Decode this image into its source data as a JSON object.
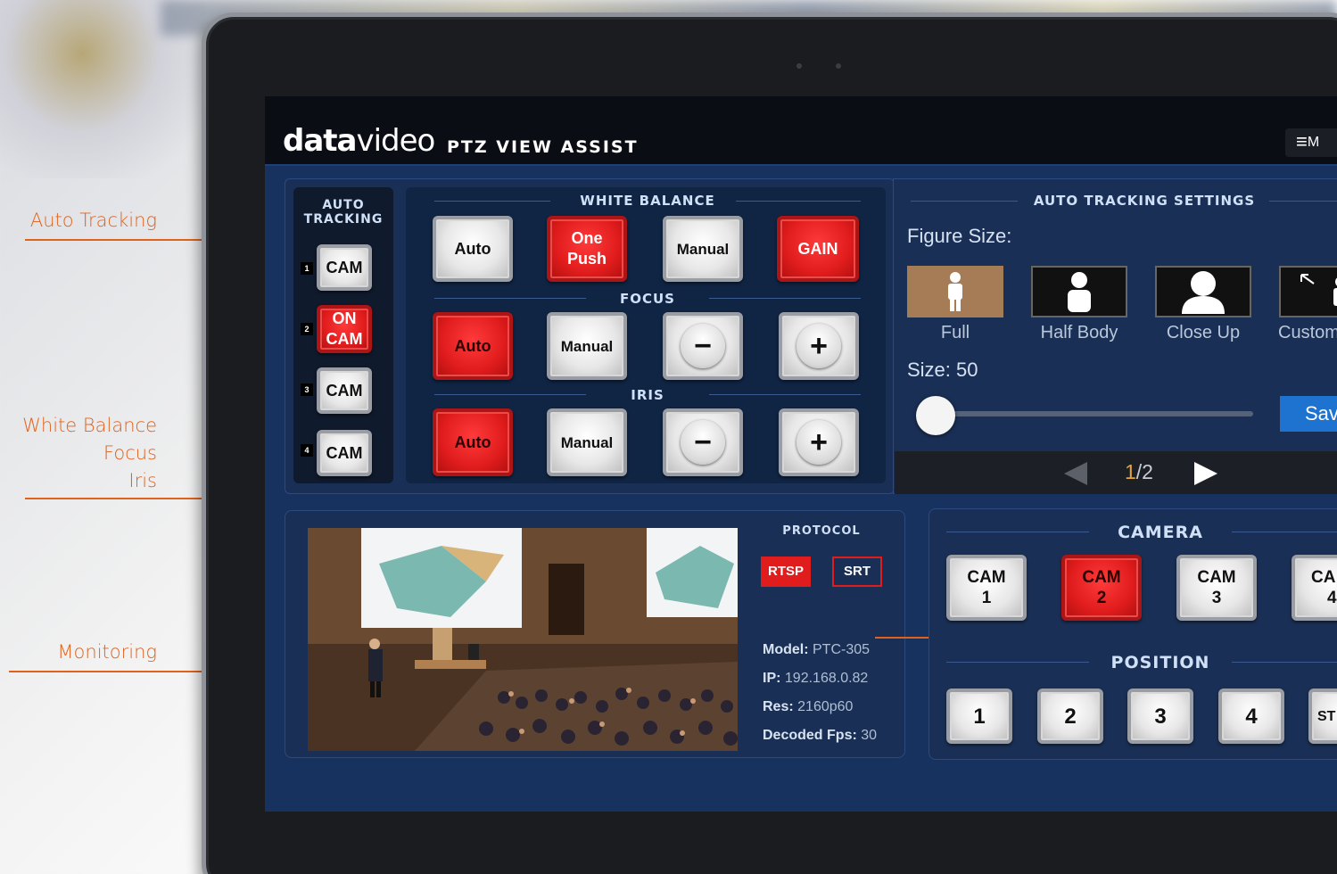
{
  "annotations": {
    "auto_tracking": "Auto Tracking",
    "white_balance": "White Balance",
    "focus": "Focus",
    "iris": "Iris",
    "monitoring": "Monitoring"
  },
  "header": {
    "brand_bold": "data",
    "brand_light": "video",
    "title": "PTZ VIEW ASSIST",
    "menu_label": "M"
  },
  "auto_tracking_panel": {
    "title_line1": "AUTO",
    "title_line2": "TRACKING",
    "cams": [
      {
        "num": "1",
        "label": "CAM",
        "active": false
      },
      {
        "num": "2",
        "label_line1": "ON",
        "label_line2": "CAM",
        "active": true
      },
      {
        "num": "3",
        "label": "CAM",
        "active": false
      },
      {
        "num": "4",
        "label": "CAM",
        "active": false
      }
    ]
  },
  "white_balance": {
    "title": "WHITE BALANCE",
    "auto": "Auto",
    "one_push_1": "One",
    "one_push_2": "Push",
    "manual": "Manual",
    "gain": "GAIN"
  },
  "focus": {
    "title": "FOCUS",
    "auto": "Auto",
    "manual": "Manual",
    "minus": "−",
    "plus": "+"
  },
  "iris": {
    "title": "IRIS",
    "auto": "Auto",
    "manual": "Manual",
    "minus": "−",
    "plus": "+"
  },
  "tracking_settings": {
    "title": "AUTO TRACKING SETTINGS",
    "figure_size_label": "Figure Size:",
    "figures": [
      {
        "label": "Full",
        "icon": "full-figure-icon",
        "selected": true
      },
      {
        "label": "Half Body",
        "icon": "half-body-icon",
        "selected": false
      },
      {
        "label": "Close Up",
        "icon": "close-up-icon",
        "selected": false
      },
      {
        "label": "Custom",
        "icon": "custom-figure-icon",
        "selected": false
      }
    ],
    "size_label": "Size: 50",
    "size_value": 50,
    "save_label": "Sav",
    "pager_current": "1",
    "pager_total": "/2"
  },
  "monitor": {
    "protocol_title": "PROTOCOL",
    "rtsp": "RTSP",
    "srt": "SRT",
    "model_key": "Model:",
    "model_val": "PTC-305",
    "ip_key": "IP:",
    "ip_val": "192.168.0.82",
    "res_key": "Res:",
    "res_val": "2160p60",
    "fps_key": "Decoded Fps:",
    "fps_val": "30"
  },
  "camera_panel": {
    "title": "CAMERA",
    "cams": [
      {
        "l1": "CAM",
        "l2": "1",
        "active": false
      },
      {
        "l1": "CAM",
        "l2": "2",
        "active": true
      },
      {
        "l1": "CAM",
        "l2": "3",
        "active": false
      },
      {
        "l1": "CA",
        "l2": "4",
        "active": false
      }
    ]
  },
  "position_panel": {
    "title": "POSITION",
    "buttons": [
      "1",
      "2",
      "3",
      "4",
      "ST"
    ]
  },
  "colors": {
    "accent_orange": "#e1621c",
    "active_red": "#e01c1c",
    "screen_blue": "#17325e",
    "save_blue": "#1f73d0"
  }
}
